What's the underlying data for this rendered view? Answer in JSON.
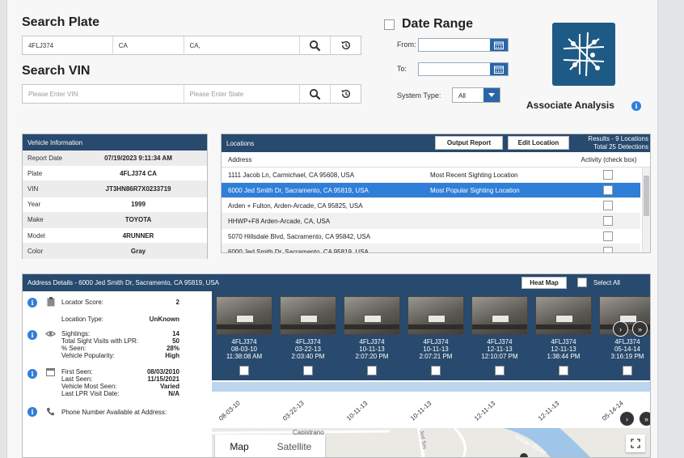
{
  "search_plate": {
    "title": "Search Plate",
    "plate": "4FLJ374",
    "state": "CA",
    "city": "CA,"
  },
  "search_vin": {
    "title": "Search VIN",
    "vin_placeholder": "Please Enter VIN",
    "state_placeholder": "Please Enter State"
  },
  "date_range": {
    "title": "Date Range",
    "from_label": "From:",
    "to_label": "To:",
    "system_type_label": "System Type:",
    "system_type_value": "All"
  },
  "associate": {
    "label": "Associate Analysis"
  },
  "vehicle_info": {
    "title": "Vehicle Information",
    "rows": [
      {
        "key": "Report Date",
        "value": "07/19/2023 9:11:34 AM"
      },
      {
        "key": "Plate",
        "value": "4FLJ374 CA"
      },
      {
        "key": "VIN",
        "value": "JT3HN86R7X0233719"
      },
      {
        "key": "Year",
        "value": "1999"
      },
      {
        "key": "Make",
        "value": "TOYOTA"
      },
      {
        "key": "Model",
        "value": "4RUNNER"
      },
      {
        "key": "Color",
        "value": "Gray"
      }
    ]
  },
  "locations": {
    "title": "Locations",
    "output_report": "Output Report",
    "edit_location": "Edit Location",
    "results_line1": "Results - 9 Locations",
    "results_line2": "Total 25 Detections",
    "col_address": "Address",
    "col_activity": "Activity (check box)",
    "rows": [
      {
        "address": "1111 Jacob Ln, Carmichael, CA 95608, USA",
        "note": "Most Recent Sighting Location"
      },
      {
        "address": "6000 Jed Smith Dr, Sacramento, CA 95819, USA",
        "note": "Most Popular Sighting Location"
      },
      {
        "address": "Arden + Fulton, Arden-Arcade, CA 95825, USA",
        "note": ""
      },
      {
        "address": "HHWP+F8 Arden-Arcade, CA, USA",
        "note": ""
      },
      {
        "address": "5070 Hillsdale Blvd, Sacramento, CA 95842, USA",
        "note": ""
      },
      {
        "address": "6000 Jed Smith Dr, Sacramento, CA 95819, USA",
        "note": ""
      }
    ]
  },
  "address_details": {
    "title": "Address Details - 6000 Jed Smith Dr, Sacramento, CA 95819, USA",
    "heat_map": "Heat Map",
    "select_all": "Select All",
    "locator_score_label": "Locator Score:",
    "locator_score": "2",
    "location_type_label": "Location Type:",
    "location_type": "UnKnown",
    "sightings_label": "Sightings:",
    "sightings": "14",
    "total_visits_label": "Total Sight Visits with LPR:",
    "total_visits": "50",
    "pct_seen_label": "% Seen:",
    "pct_seen": "28%",
    "popularity_label": "Vehicle Popularity:",
    "popularity": "High",
    "first_seen_label": "First Seen:",
    "first_seen": "08/03/2010",
    "last_seen_label": "Last Seen:",
    "last_seen": "11/15/2021",
    "most_seen_label": "Vehicle Most Seen:",
    "most_seen": "Varied",
    "last_lpr_label": "Last LPR Visit Date:",
    "last_lpr": "N/A",
    "phone_label": "Phone Number Available at Address:"
  },
  "detections": [
    {
      "plate": "4FLJ374",
      "date": "08-03-10",
      "time": "11:38:08 AM",
      "tl": "08-03-10"
    },
    {
      "plate": "4FLJ374",
      "date": "03-22-13",
      "time": "2:03:40 PM",
      "tl": "03-22-13"
    },
    {
      "plate": "4FLJ374",
      "date": "10-11-13",
      "time": "2:07:20 PM",
      "tl": "10-11-13"
    },
    {
      "plate": "4FLJ374",
      "date": "10-11-13",
      "time": "2:07:21 PM",
      "tl": "10-11-13"
    },
    {
      "plate": "4FLJ374",
      "date": "12-11-13",
      "time": "12:10:07 PM",
      "tl": "12-11-13"
    },
    {
      "plate": "4FLJ374",
      "date": "12-11-13",
      "time": "1:38:44 PM",
      "tl": "12-11-13"
    },
    {
      "plate": "4FLJ374",
      "date": "05-14-14",
      "time": "3:16:19 PM",
      "tl": "05-14-14"
    }
  ],
  "map": {
    "tab_map": "Map",
    "tab_satellite": "Satellite",
    "label_capistrano": "Capistrano",
    "label_river": "erican River",
    "label_road": "Jed Sm"
  },
  "colors": {
    "header_navy": "#274a6e",
    "selected_row": "#2f7ed8",
    "logo_bg": "#1e5a86"
  }
}
